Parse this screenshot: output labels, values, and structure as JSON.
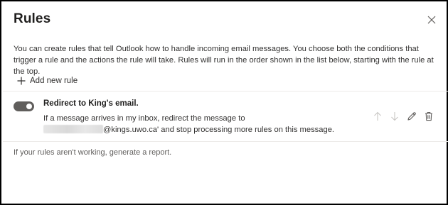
{
  "dialog": {
    "title": "Rules",
    "description": "You can create rules that tell Outlook how to handle incoming email messages. You choose both the conditions that trigger a rule and the actions the rule will take. Rules will run in the order shown in the list below, starting with the rule at the top.",
    "add_rule_label": "Add new rule",
    "footer_note": "If your rules aren't working, generate a report."
  },
  "rules": [
    {
      "enabled": true,
      "name": "Redirect to King's email.",
      "description_line1": "If a message arrives in my inbox, redirect the message to",
      "description_line2_suffix": "@kings.uwo.ca' and stop processing more rules on this message."
    }
  ],
  "icons": {
    "close": "close-icon",
    "add": "plus-icon",
    "move_up": "arrow-up-icon",
    "move_down": "arrow-down-icon",
    "edit": "pencil-icon",
    "delete": "trash-icon"
  },
  "colors": {
    "toggle_on": "#605e5c",
    "text": "#323130",
    "disabled_icon": "#c8c6c4"
  }
}
